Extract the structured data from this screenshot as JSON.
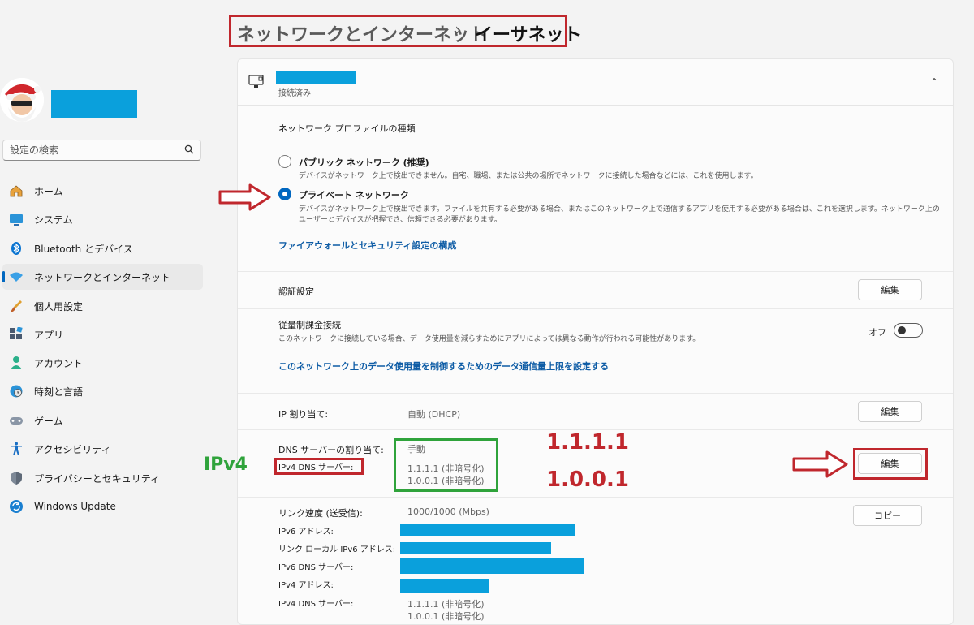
{
  "breadcrumb": {
    "parent": "ネットワークとインターネット",
    "separator": "›",
    "current": "イーサネット"
  },
  "sidebar": {
    "search_placeholder": "設定の検索",
    "items": [
      {
        "label": "ホーム",
        "icon": "home-icon"
      },
      {
        "label": "システム",
        "icon": "system-icon"
      },
      {
        "label": "Bluetooth とデバイス",
        "icon": "bluetooth-icon"
      },
      {
        "label": "ネットワークとインターネット",
        "icon": "wifi-icon",
        "active": true
      },
      {
        "label": "個人用設定",
        "icon": "brush-icon"
      },
      {
        "label": "アプリ",
        "icon": "apps-icon"
      },
      {
        "label": "アカウント",
        "icon": "account-icon"
      },
      {
        "label": "時刻と言語",
        "icon": "globe-clock-icon"
      },
      {
        "label": "ゲーム",
        "icon": "gamepad-icon"
      },
      {
        "label": "アクセシビリティ",
        "icon": "accessibility-icon"
      },
      {
        "label": "プライバシーとセキュリティ",
        "icon": "shield-icon"
      },
      {
        "label": "Windows Update",
        "icon": "update-icon"
      }
    ]
  },
  "connection": {
    "status": "接続済み"
  },
  "profile": {
    "heading": "ネットワーク プロファイルの種類",
    "public_label": "パブリック ネットワーク (推奨)",
    "public_desc": "デバイスがネットワーク上で検出できません。自宅、職場、または公共の場所でネットワークに接続した場合などには、これを使用します。",
    "private_label": "プライベート ネットワーク",
    "private_desc_1": "デバイスがネットワーク上で検出できます。ファイルを共有する必要がある場合、またはこのネットワーク上で通信するアプリを使用する必要がある場合は、これを選択します。ネットワーク上の",
    "private_desc_2": "ユーザーとデバイスが把握でき、信頼できる必要があります。",
    "selected": "private",
    "firewall_link": "ファイアウォールとセキュリティ設定の構成"
  },
  "auth": {
    "label": "認証設定",
    "edit": "編集"
  },
  "metered": {
    "label": "従量制課金接続",
    "desc": "このネットワークに接続している場合、データ使用量を減らすためにアプリによっては異なる動作が行われる可能性があります。",
    "state": "オフ",
    "link": "このネットワーク上のデータ使用量を制御するためのデータ通信量上限を設定する"
  },
  "ip": {
    "label": "IP 割り当て:",
    "value": "自動 (DHCP)",
    "edit": "編集"
  },
  "dns": {
    "label": "DNS サーバーの割り当て:",
    "value": "手動",
    "ipv4_label": "IPv4 DNS サーバー:",
    "ipv4_1": "1.1.1.1 (非暗号化)",
    "ipv4_2": "1.0.0.1 (非暗号化)",
    "edit": "編集"
  },
  "annotations": {
    "ipv4": "IPv4",
    "dns1": "1.1.1.1",
    "dns2": "1.0.0.1"
  },
  "properties": {
    "link_speed_label": "リンク速度 (送受信):",
    "link_speed_value": "1000/1000 (Mbps)",
    "copy": "コピー",
    "ipv6_addr_label": "IPv6 アドレス:",
    "link_local_label": "リンク ローカル IPv6 アドレス:",
    "ipv6_dns_label": "IPv6 DNS サーバー:",
    "ipv4_addr_label": "IPv4 アドレス:",
    "ipv4_dns_label": "IPv4 DNS サーバー:",
    "ipv4_dns_1": "1.1.1.1 (非暗号化)",
    "ipv4_dns_2": "1.0.0.1 (非暗号化)"
  },
  "colors": {
    "accent": "#0067c0",
    "redact": "#0aa0dc",
    "annotation_red": "#c0272d",
    "annotation_green": "#2fa33b"
  }
}
